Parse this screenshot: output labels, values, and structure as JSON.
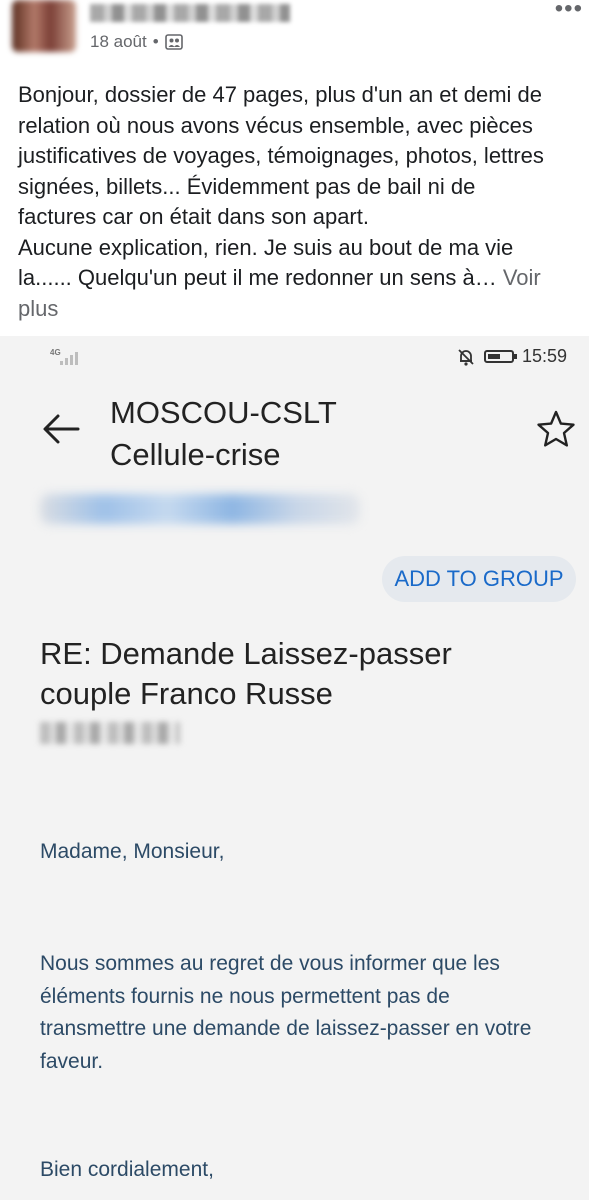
{
  "post": {
    "date": "18 août",
    "separator": "•",
    "text_lines": [
      "Bonjour, dossier de 47 pages, plus d'un an et demi de",
      "relation où nous avons vécus ensemble, avec pièces",
      "justificatives de voyages, témoignages, photos, lettres",
      "signées, billets... Évidemment pas de bail ni de",
      "factures car on était dans son apart.",
      "Aucune explication, rien. Je suis au bout de ma vie",
      "la......  Quelqu'un peut il me redonner un sens à…"
    ],
    "see_more_a": "Voir",
    "see_more_b": "plus",
    "audience_icon": "friends-icon",
    "more_icon": "more-options-icon",
    "more_glyph": "•••"
  },
  "phone": {
    "status": {
      "network": "4G",
      "time": "15:59",
      "battery_level": 0.55
    },
    "sender_line1": "MOSCOU-CSLT",
    "sender_line2": "Cellule-crise",
    "add_to_group": "ADD TO GROUP",
    "subject_line1": "RE: Demande Laissez-passer",
    "subject_line2": "couple Franco Russe",
    "greeting": "Madame, Monsieur,",
    "message_lines": [
      "Nous sommes au regret de vous informer que les",
      "éléments fournis ne nous permettent pas de",
      "transmettre une demande de laissez-passer en votre",
      "faveur."
    ],
    "closing": "Bien cordialement,",
    "colors": {
      "accent": "#1a6ac9",
      "body_text": "#2c4a66",
      "chip_bg": "#e5e9ee"
    }
  }
}
